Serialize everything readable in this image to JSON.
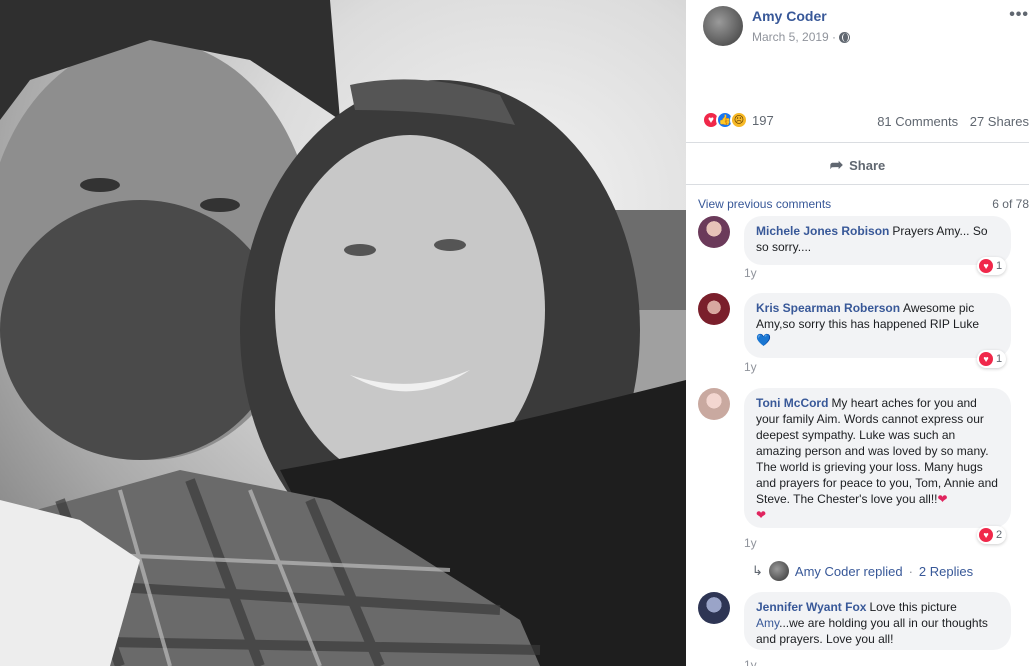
{
  "post": {
    "author": "Amy Coder",
    "date": "March 5, 2019 ·",
    "more_icon": "more-options-icon",
    "privacy_icon": "globe-icon"
  },
  "photo": {
    "icon": "photo-image"
  },
  "reactions": {
    "count": "197",
    "types": [
      "love",
      "like",
      "sad"
    ],
    "comments": "81 Comments",
    "shares": "27 Shares"
  },
  "actions": {
    "share_label": "Share"
  },
  "comments_section": {
    "view_previous": "View previous comments",
    "count": "6 of 78",
    "items": [
      {
        "name": "Michele Jones Robison",
        "text": "Prayers Amy... So so sorry....",
        "time": "1y",
        "likes": "1",
        "avatar_color": "#6b3a5a"
      },
      {
        "name": "Kris Spearman Roberson",
        "text": "Awesome pic Amy,so sorry this has happened RIP Luke",
        "emoji": "💙",
        "time": "1y",
        "likes": "1",
        "avatar_color": "#7a1f2b"
      },
      {
        "name": "Toni McCord",
        "text": "My heart aches for you and your family Aim. Words cannot express our deepest sympathy. Luke was such an amazing person and was loved by so many. The world is grieving your loss. Many hugs and prayers for peace to you, Tom, Annie and Steve. The Chester's love you all!!",
        "emoji": "❤",
        "emoji2": "❤",
        "time": "1y",
        "likes": "2",
        "avatar_color": "#c9a9a0"
      },
      {
        "name": "Jennifer Wyant Fox",
        "text": "Love this picture",
        "text_link": "Amy",
        "text_rest": "...we are holding you all in our thoughts and prayers. Love you all!",
        "time": "1y",
        "avatar_color": "#2e3554"
      }
    ],
    "replied": {
      "label": "Amy Coder replied",
      "separator": "·",
      "replies": "2 Replies"
    }
  },
  "colors": {
    "link": "#385898",
    "muted": "#90949c",
    "bubble": "#f2f3f5",
    "love": "#f0284a",
    "like": "#1877f2"
  }
}
